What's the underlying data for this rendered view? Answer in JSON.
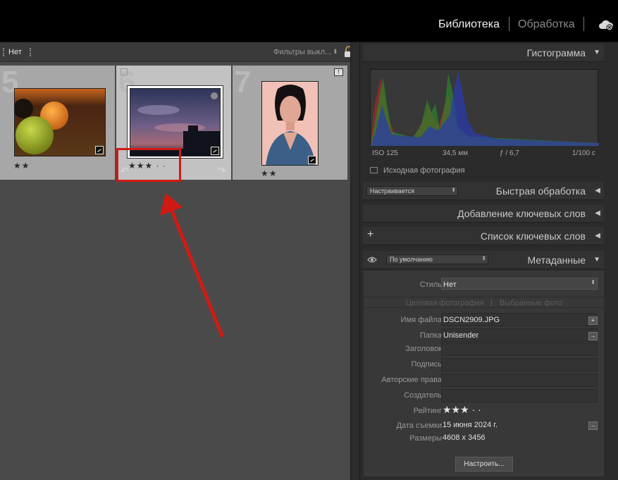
{
  "modules": {
    "library": "Библиотека",
    "develop": "Обработка"
  },
  "filter_bar": {
    "flag_filter": "Нет",
    "filters": "Фильтры выкл...",
    "filters_arrow": "⬍"
  },
  "grid": {
    "cells": [
      {
        "index": "5",
        "stars": "★★"
      },
      {
        "index": "6",
        "stars": "★★★ · ·"
      },
      {
        "index": "7",
        "stars": "★★"
      }
    ]
  },
  "histogram": {
    "title": "Гистограмма",
    "iso": "ISO 125",
    "focal": "34,5 мм",
    "aperture": "ƒ / 6,7",
    "shutter": "1/100 с",
    "original_photo": "Исходная фотография"
  },
  "quick_develop": {
    "title": "Быстрая обработка",
    "preset": "Настраивается"
  },
  "keywording": {
    "title": "Добавление ключевых слов"
  },
  "keyword_list": {
    "title": "Список ключевых слов",
    "add": "+"
  },
  "metadata": {
    "title": "Метаданные",
    "preset": "По умолчанию",
    "style_label": "Стиль",
    "style_value": "Нет",
    "tab_target": "Целевая фотография",
    "tab_selected": "Выбранные фото",
    "fields": [
      {
        "label": "Имя файла",
        "value": "DSCN2909.JPG"
      },
      {
        "label": "Папка",
        "value": "Unisender"
      },
      {
        "label": "Заголовок",
        "value": ""
      },
      {
        "label": "Подпись",
        "value": ""
      },
      {
        "label": "Авторские права",
        "value": ""
      },
      {
        "label": "Создатель",
        "value": ""
      },
      {
        "label": "Рейтинг",
        "value": "★★★ · ·"
      },
      {
        "label": "Дата съемки",
        "value": "15 июня 2024 г."
      },
      {
        "label": "Размеры",
        "value": "4608 x 3456"
      }
    ],
    "configure_button": "Настроить..."
  },
  "colors": {
    "highlight": "#d11a14",
    "panel": "#2b2b2b",
    "grid": "#4a4a4a"
  }
}
